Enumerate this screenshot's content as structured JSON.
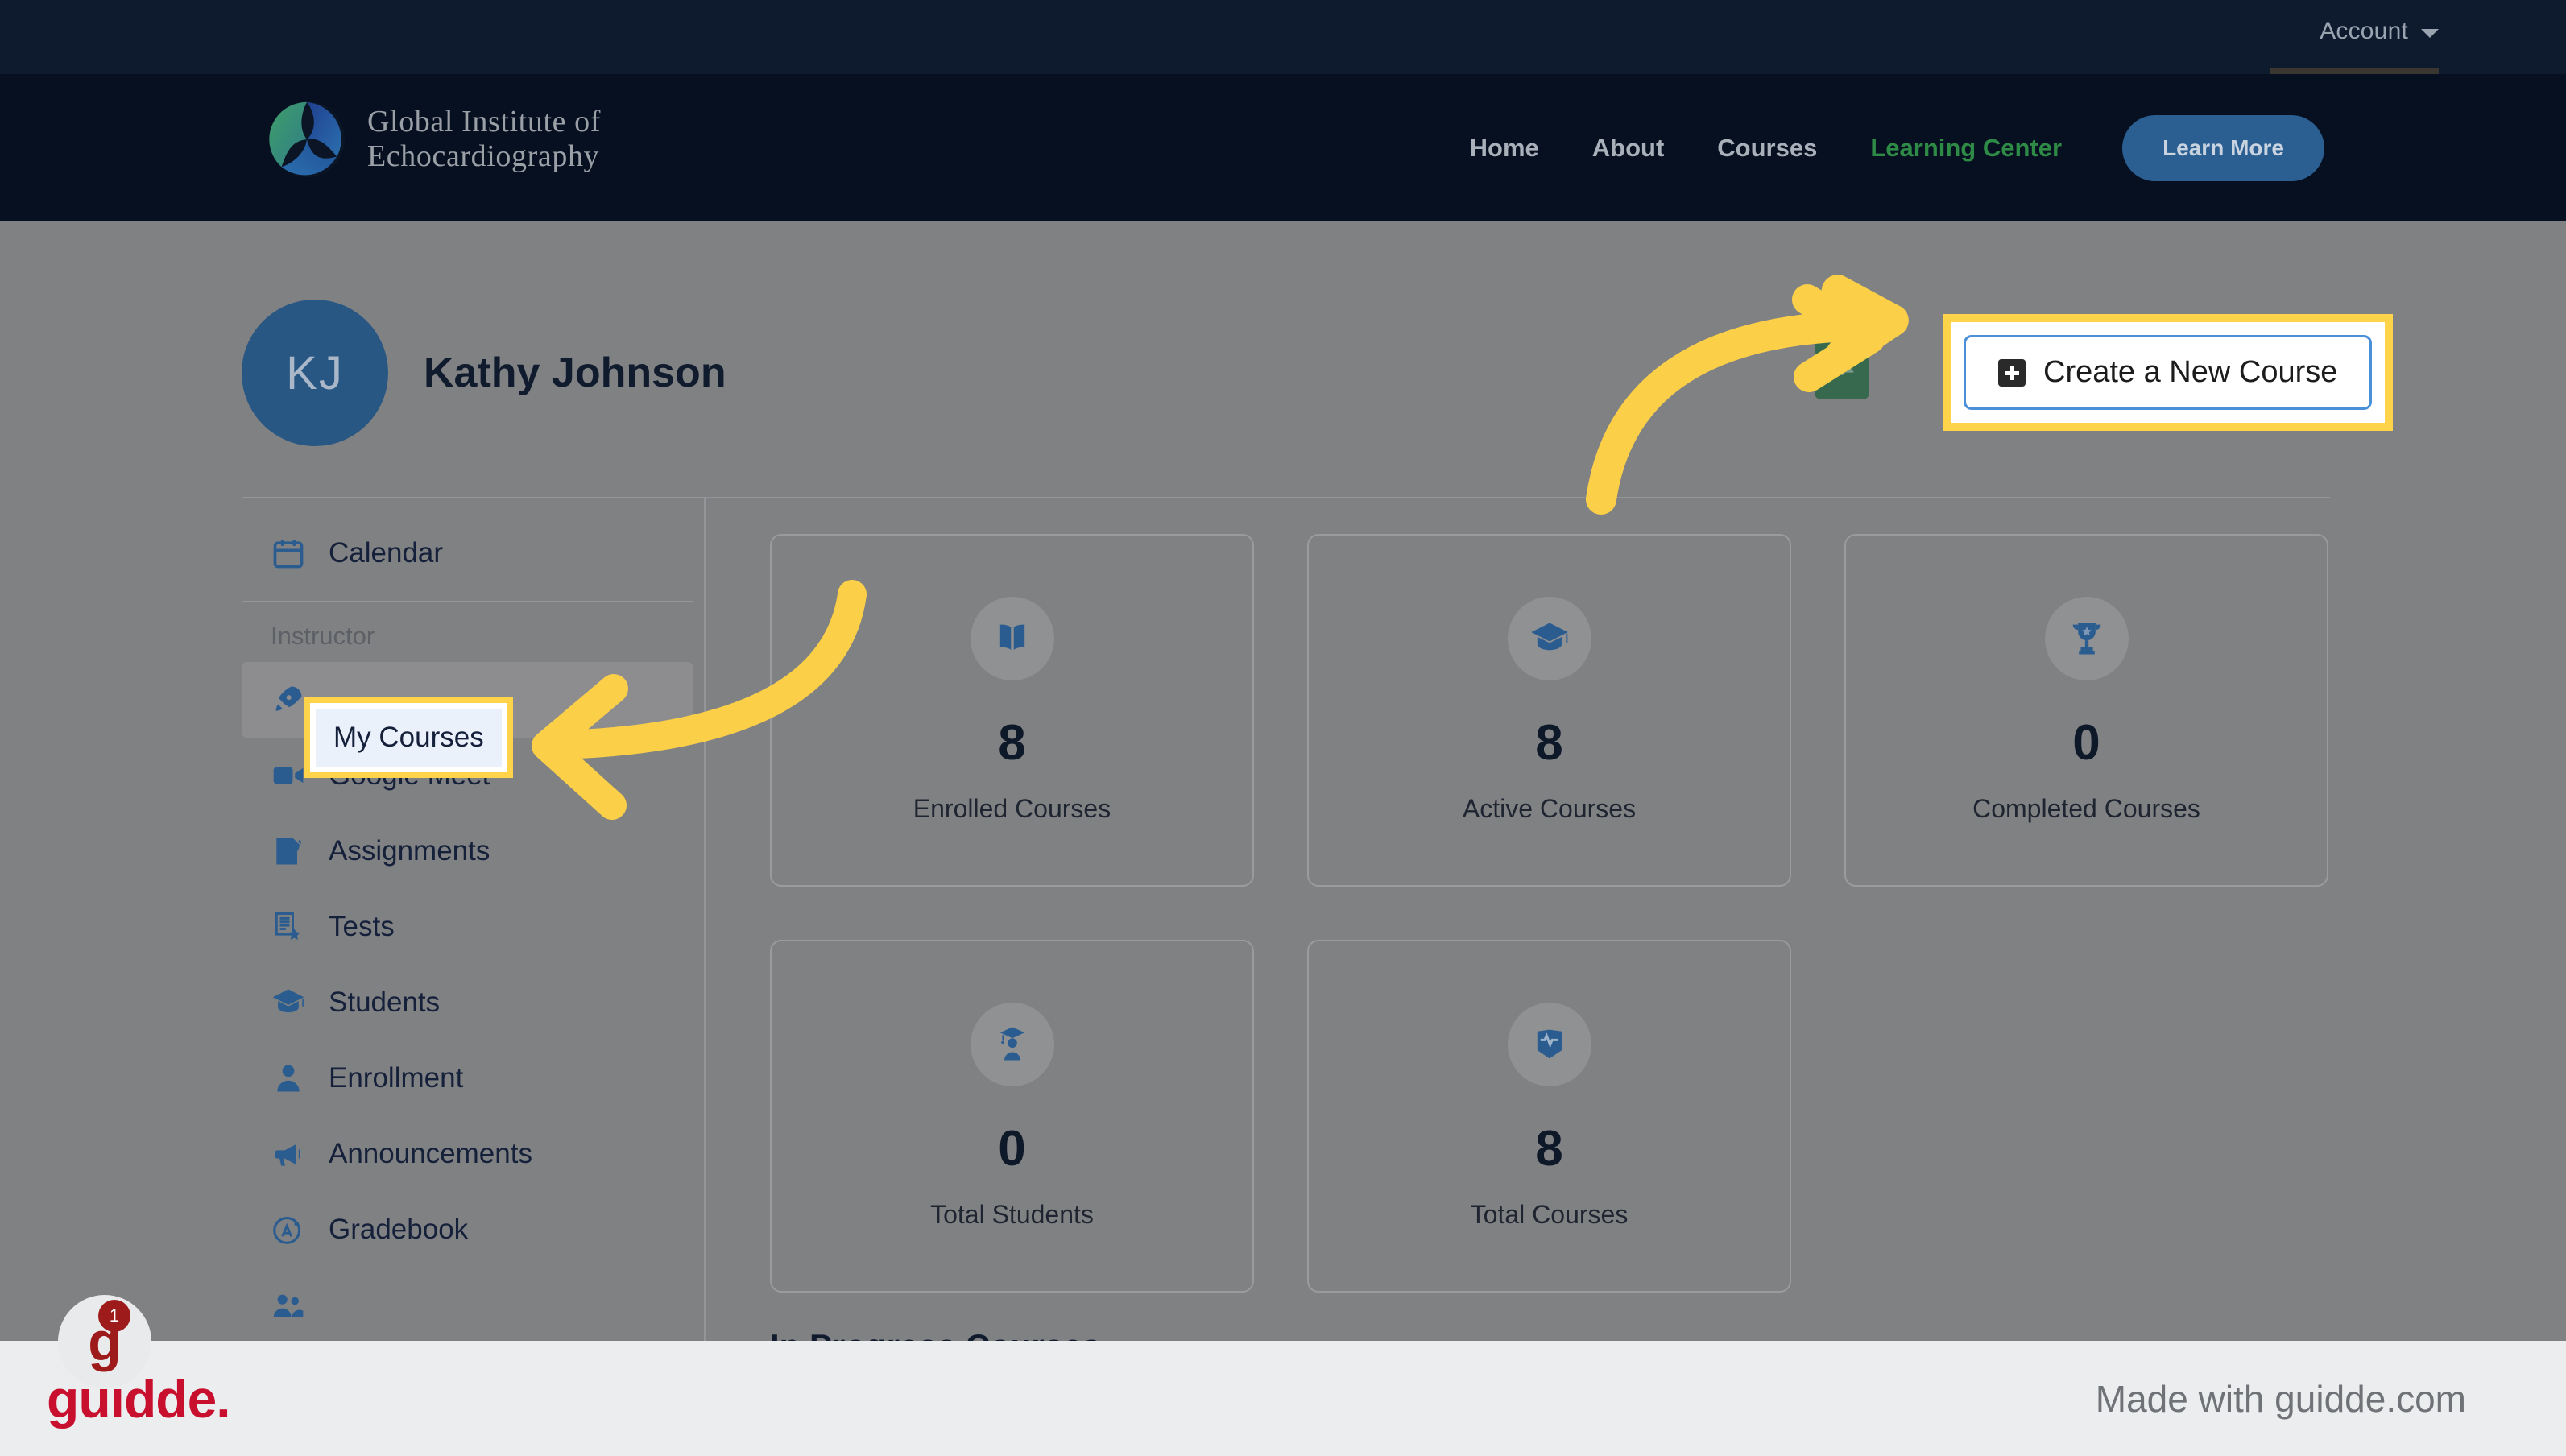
{
  "topbar": {
    "account_label": "Account",
    "caret_icon": "chevron-down-icon"
  },
  "brand": {
    "line1": "Global Institute of",
    "line2": "Echocardiography",
    "logo_icon": "triskelion-circle-logo"
  },
  "nav": {
    "links": [
      {
        "label": "Home",
        "active": false
      },
      {
        "label": "About",
        "active": false
      },
      {
        "label": "Courses",
        "active": false
      },
      {
        "label": "Learning Center",
        "active": true
      }
    ],
    "cta_label": "Learn More",
    "active_color": "#2e8b46",
    "cta_color": "#2b5f92"
  },
  "profile": {
    "initials": "KJ",
    "name": "Kathy Johnson"
  },
  "actions": {
    "create_course_label": "Create a New Course",
    "create_course_icon": "plus-square-icon",
    "notification_icon": "bell-icon",
    "notification_bg": "#37694f",
    "highlight_color": "#ffd44a"
  },
  "sidebar": {
    "top_items": [
      {
        "label": "Calendar",
        "icon": "calendar-icon"
      }
    ],
    "group_label": "Instructor",
    "items": [
      {
        "label": "My Courses",
        "icon": "rocket-icon",
        "active": true
      },
      {
        "label": "Google Meet",
        "icon": "video-camera-icon",
        "active": false
      },
      {
        "label": "Assignments",
        "icon": "checklist-icon",
        "active": false
      },
      {
        "label": "Tests",
        "icon": "document-star-icon",
        "active": false
      },
      {
        "label": "Students",
        "icon": "graduation-cap-icon",
        "active": false
      },
      {
        "label": "Enrollment",
        "icon": "person-icon",
        "active": false
      },
      {
        "label": "Announcements",
        "icon": "megaphone-icon",
        "active": false
      },
      {
        "label": "Gradebook",
        "icon": "grade-a-plus-icon",
        "active": false
      }
    ]
  },
  "stats": {
    "rows": [
      [
        {
          "value": "8",
          "label": "Enrolled Courses",
          "icon": "open-book-icon"
        },
        {
          "value": "8",
          "label": "Active Courses",
          "icon": "graduation-cap-icon"
        },
        {
          "value": "0",
          "label": "Completed Courses",
          "icon": "trophy-icon"
        }
      ],
      [
        {
          "value": "0",
          "label": "Total Students",
          "icon": "student-icon"
        },
        {
          "value": "8",
          "label": "Total Courses",
          "icon": "heartbeat-book-icon"
        }
      ]
    ]
  },
  "section": {
    "in_progress_heading": "In Progress Courses"
  },
  "footer": {
    "logo_text": "guidde.",
    "made_with": "Made with guidde.com",
    "logo_color": "#c8102e",
    "chat_badge_count": "1",
    "chat_icon": "chat-g-icon"
  }
}
